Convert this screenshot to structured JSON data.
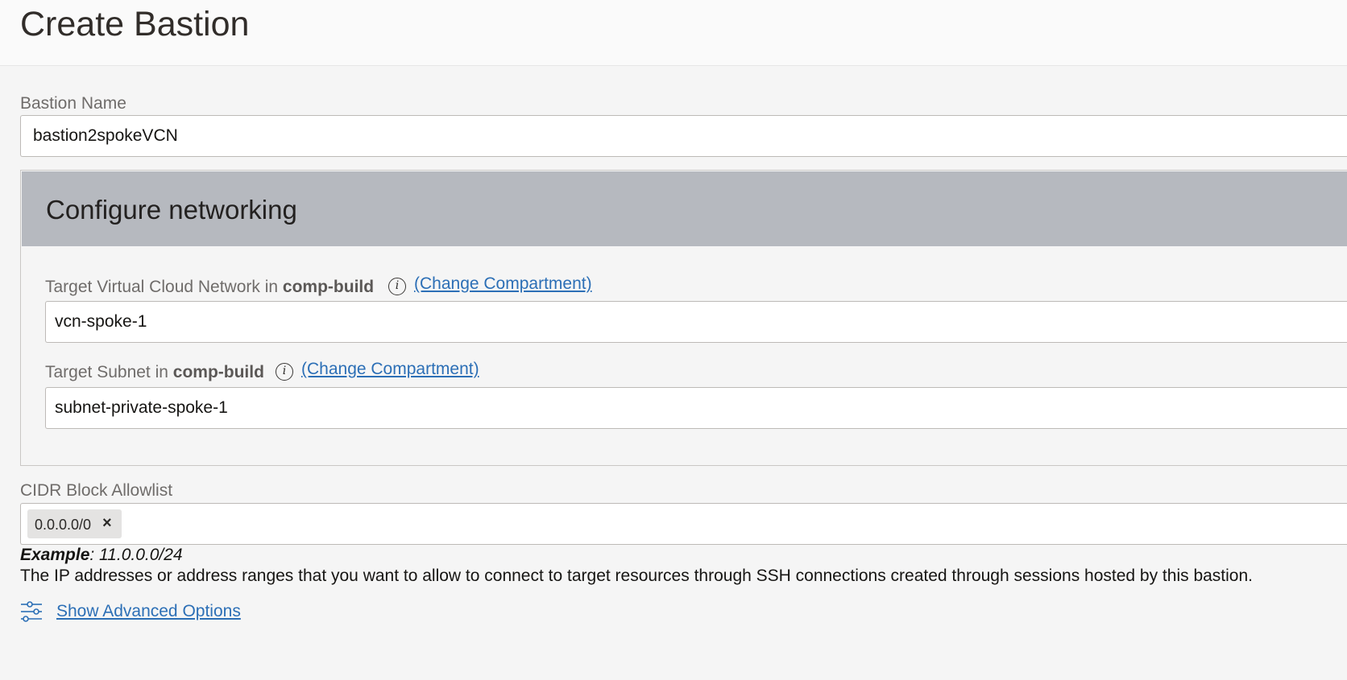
{
  "header": {
    "title": "Create Bastion"
  },
  "bastion_name": {
    "label": "Bastion Name",
    "value": "bastion2spokeVCN"
  },
  "networking": {
    "title": "Configure networking",
    "vcn": {
      "label_prefix": "Target Virtual Cloud Network in ",
      "compartment": "comp-build",
      "info_icon": "info-icon",
      "change_link": "(Change Compartment)",
      "value": "vcn-spoke-1"
    },
    "subnet": {
      "label_prefix": "Target Subnet in ",
      "compartment": "comp-build",
      "info_icon": "info-icon",
      "change_link": "(Change Compartment)",
      "value": "subnet-private-spoke-1"
    }
  },
  "cidr": {
    "label": "CIDR Block Allowlist",
    "chips": [
      "0.0.0.0/0"
    ],
    "remove_icon": "close-icon",
    "remove_glyph": "×",
    "example_label": "Example",
    "example_value": ": 11.0.0.0/24",
    "help": "The IP addresses or address ranges that you want to allow to connect to target resources through SSH connections created through sessions hosted by this bastion."
  },
  "advanced": {
    "icon": "sliders-icon",
    "label": "Show Advanced Options"
  },
  "colors": {
    "link": "#2c6fb6",
    "panel_header": "#b6b9bf",
    "page_bg": "#f5f5f5"
  }
}
